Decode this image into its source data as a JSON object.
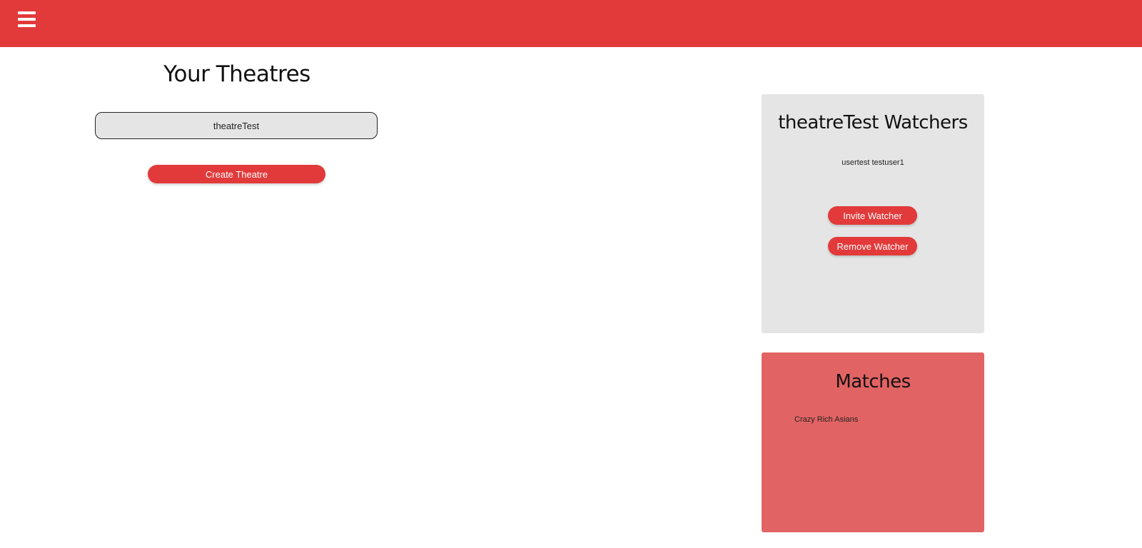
{
  "header": {
    "menu_icon": "hamburger-menu-icon",
    "accent_color": "#e23a3a"
  },
  "theatres": {
    "title": "Your Theatres",
    "items": [
      "theatreTest"
    ],
    "create_label": "Create Theatre"
  },
  "watchers": {
    "title": "theatreTest Watchers",
    "list_text": "usertest testuser1",
    "invite_label": "Invite Watcher",
    "remove_label": "Remove Watcher",
    "panel_color": "#e5e5e5"
  },
  "matches": {
    "title": "Matches",
    "items": [
      "Crazy Rich Asians"
    ],
    "panel_color": "#e26363"
  }
}
